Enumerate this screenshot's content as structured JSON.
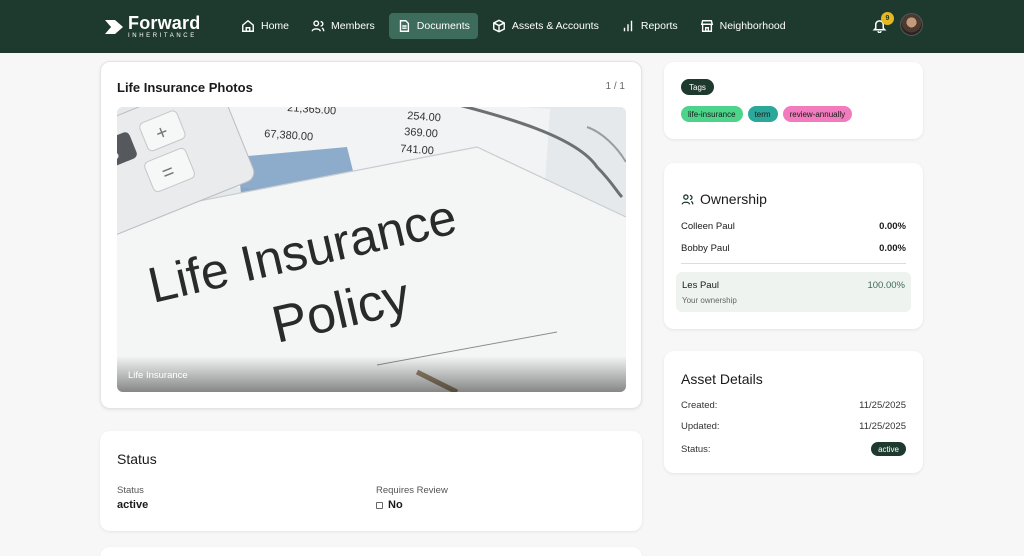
{
  "brand": {
    "name": "Forward",
    "tagline": "INHERITANCE"
  },
  "nav": {
    "items": [
      {
        "label": "Home",
        "icon": "home-icon"
      },
      {
        "label": "Members",
        "icon": "users-icon"
      },
      {
        "label": "Documents",
        "icon": "document-icon",
        "active": true
      },
      {
        "label": "Assets & Accounts",
        "icon": "box-icon"
      },
      {
        "label": "Reports",
        "icon": "bar-chart-icon"
      },
      {
        "label": "Neighborhood",
        "icon": "store-icon"
      }
    ],
    "notification_count": "9"
  },
  "photos": {
    "title": "Life Insurance Photos",
    "counter": "1 / 1",
    "caption": "Life Insurance",
    "image_text": [
      "Life Insurance",
      "Policy"
    ],
    "figures": [
      "21,365.00",
      "67,380.00",
      "254.00",
      "369.00",
      "741.00"
    ]
  },
  "status": {
    "title": "Status",
    "status_label": "Status",
    "status_value": "active",
    "review_label": "Requires Review",
    "review_value": "No"
  },
  "tags": {
    "header": "Tags",
    "items": [
      {
        "label": "life-insurance",
        "color": "#4cd48a"
      },
      {
        "label": "term",
        "color": "#2aa89a"
      },
      {
        "label": "review-annually",
        "color": "#f27bbd"
      }
    ]
  },
  "ownership": {
    "title": "Ownership",
    "owners": [
      {
        "name": "Colleen Paul",
        "pct": "0.00%"
      },
      {
        "name": "Bobby Paul",
        "pct": "0.00%"
      }
    ],
    "self": {
      "name": "Les Paul",
      "pct": "100.00%",
      "note": "Your ownership"
    }
  },
  "details": {
    "title": "Asset Details",
    "created_label": "Created:",
    "created_value": "11/25/2025",
    "updated_label": "Updated:",
    "updated_value": "11/25/2025",
    "status_label": "Status:",
    "status_value": "active"
  },
  "colors": {
    "nav_bg": "#1e3a2f",
    "nav_active": "#3d6b5c",
    "badge": "#e8b820"
  }
}
